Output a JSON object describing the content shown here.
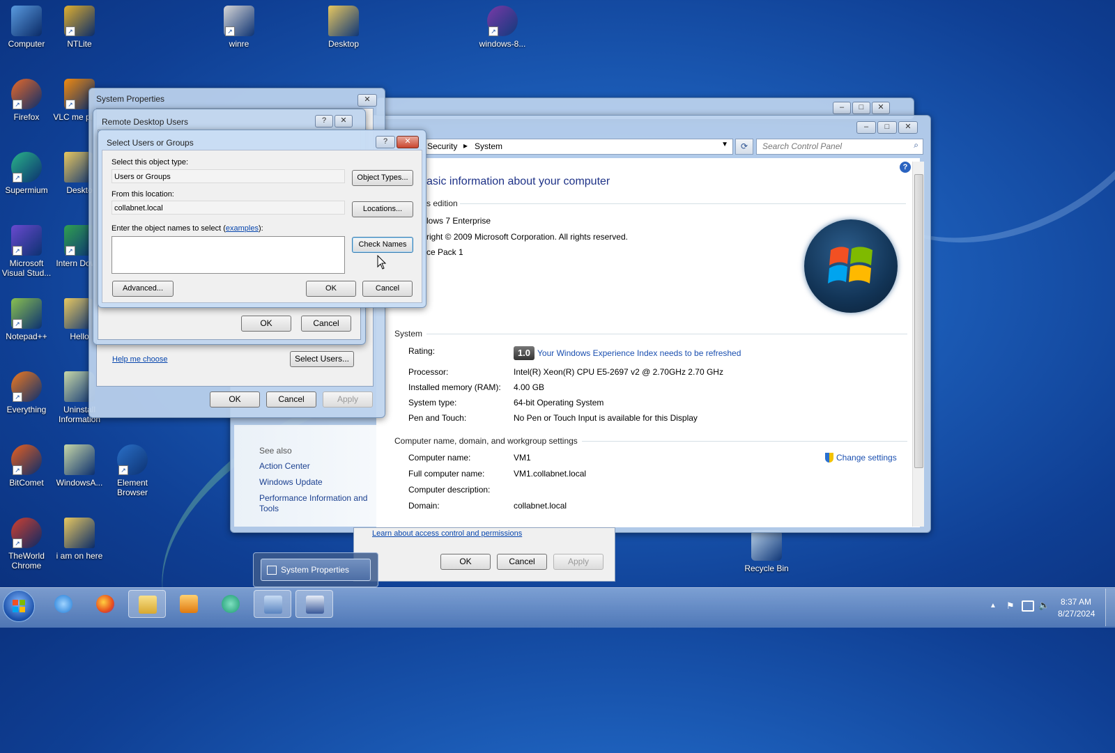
{
  "desktop": {
    "icons": [
      {
        "label": "Computer",
        "icon": "computer-icon",
        "color": "#5a9be0"
      },
      {
        "label": "NTLite",
        "icon": "ntlite-icon",
        "color": "#e0b030"
      },
      {
        "label": "winre",
        "icon": "disc-image-icon",
        "color": "#d8d8d8"
      },
      {
        "label": "Desktop",
        "icon": "folder-icon",
        "color": "#e8c860"
      },
      {
        "label": "windows-8...",
        "icon": "firefox-file-icon",
        "color": "#7a3aa8"
      },
      {
        "label": "Firefox",
        "icon": "firefox-icon",
        "color": "#e86a2a"
      },
      {
        "label": "VLC me playe",
        "icon": "vlc-icon",
        "color": "#f08a10"
      },
      {
        "label": "Supermium",
        "icon": "supermium-icon",
        "color": "#2ab58a"
      },
      {
        "label": "Deskto",
        "icon": "folder-icon",
        "color": "#e8c860"
      },
      {
        "label": "Microsoft Visual Stud...",
        "icon": "visual-studio-icon",
        "color": "#6a4ad0"
      },
      {
        "label": "Intern Downl",
        "icon": "download-manager-icon",
        "color": "#30a050"
      },
      {
        "label": "Notepad++",
        "icon": "notepad-plus-icon",
        "color": "#8ac050"
      },
      {
        "label": "Hello",
        "icon": "folder-icon",
        "color": "#e8c860"
      },
      {
        "label": "Everything",
        "icon": "everything-icon",
        "color": "#f07a20"
      },
      {
        "label": "Uninstall Information",
        "icon": "folder-icon",
        "color": "#c8d8a8"
      },
      {
        "label": "BitComet",
        "icon": "bitcomet-icon",
        "color": "#e86020"
      },
      {
        "label": "WindowsA...",
        "icon": "folder-icon",
        "color": "#c8d8a8"
      },
      {
        "label": "Element Browser",
        "icon": "element-browser-icon",
        "color": "#2a70c8"
      },
      {
        "label": "TheWorld Chrome",
        "icon": "theworld-chrome-icon",
        "color": "#d04030"
      },
      {
        "label": "i am on here",
        "icon": "folder-icon",
        "color": "#e8c860"
      },
      {
        "label": "Recycle Bin",
        "icon": "recycle-bin-icon",
        "color": "#b8d0e8"
      }
    ]
  },
  "system_properties": {
    "title": "System Properties",
    "help_link": "Help me choose",
    "select_users": "Select Users...",
    "ok": "OK",
    "cancel": "Cancel",
    "apply": "Apply",
    "learn_link": "Learn about access control and permissions"
  },
  "remote_desktop_users": {
    "title": "Remote Desktop Users",
    "ok": "OK",
    "cancel": "Cancel"
  },
  "select_users": {
    "title": "Select Users or Groups",
    "help": "?",
    "object_type_label": "Select this object type:",
    "object_type_value": "Users or Groups",
    "object_types_btn": "Object Types...",
    "location_label": "From this location:",
    "location_value": "collabnet.local",
    "locations_btn": "Locations...",
    "names_label_pre": "Enter the object names to select (",
    "names_label_link": "examples",
    "names_label_post": "):",
    "names_value": "",
    "check_names_btn": "Check Names",
    "advanced_btn": "Advanced...",
    "ok": "OK",
    "cancel": "Cancel"
  },
  "control_panel": {
    "breadcrumb_a": "Security",
    "breadcrumb_b": "System",
    "search_placeholder": "Search Control Panel",
    "heading": "asic information about your computer",
    "edition_section": "s edition",
    "edition": "lows 7 Enterprise",
    "copyright": "right © 2009 Microsoft Corporation.  All rights reserved.",
    "service_pack": "ce Pack 1",
    "system_section": "System",
    "rating_label": "Rating:",
    "rating_badge": "1.0",
    "rating_link": "Your Windows Experience Index needs to be refreshed",
    "rows": [
      {
        "k": "Processor:",
        "v": "Intel(R) Xeon(R) CPU E5-2697 v2 @ 2.70GHz   2.70 GHz"
      },
      {
        "k": "Installed memory (RAM):",
        "v": "4.00 GB"
      },
      {
        "k": "System type:",
        "v": "64-bit Operating System"
      },
      {
        "k": "Pen and Touch:",
        "v": "No Pen or Touch Input is available for this Display"
      }
    ],
    "computer_section": "Computer name, domain, and workgroup settings",
    "change_settings": "Change settings",
    "computer_rows": [
      {
        "k": "Computer name:",
        "v": "VM1"
      },
      {
        "k": "Full computer name:",
        "v": "VM1.collabnet.local"
      },
      {
        "k": "Computer description:",
        "v": ""
      },
      {
        "k": "Domain:",
        "v": "collabnet.local"
      }
    ],
    "see_also": "See also",
    "see_also_links": [
      "Action Center",
      "Windows Update",
      "Performance Information and Tools"
    ]
  },
  "taskbar": {
    "thumbnail_label": "System Properties",
    "time": "8:37 AM",
    "date": "8/27/2024"
  }
}
